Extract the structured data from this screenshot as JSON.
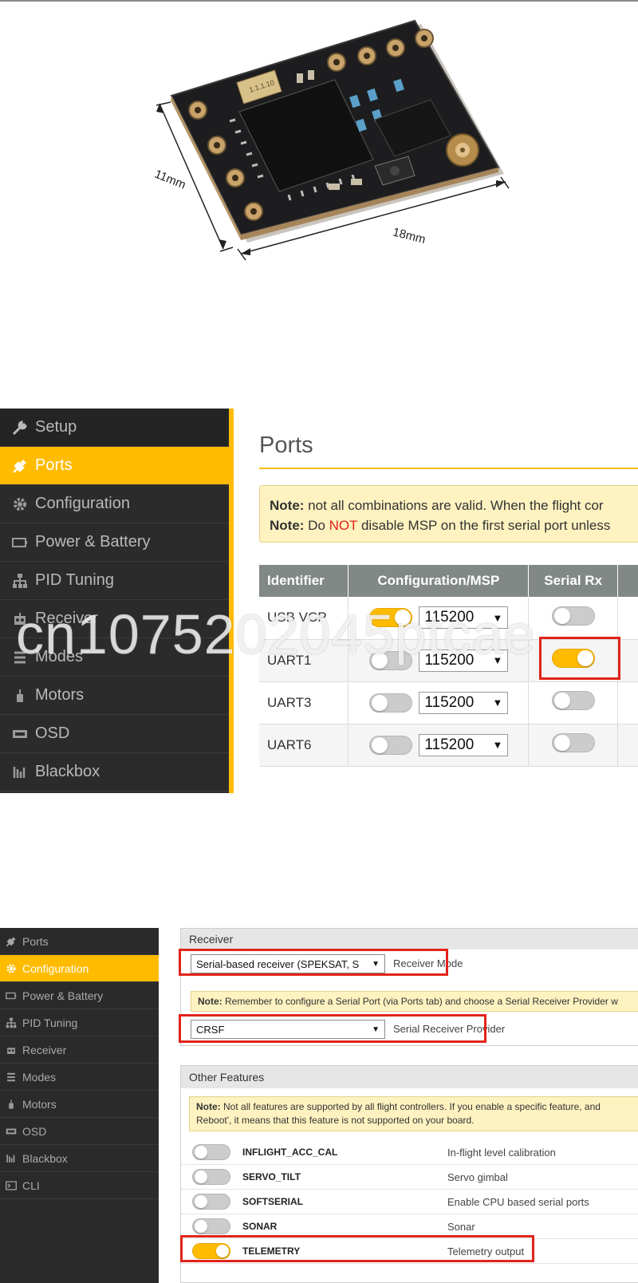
{
  "product_image": {
    "width_label": "11mm",
    "length_label": "18mm",
    "chip_marking": "1.1.1.10"
  },
  "ports_screen": {
    "sidebar": [
      {
        "label": "Setup",
        "icon": "wrench-icon"
      },
      {
        "label": "Ports",
        "icon": "plug-icon"
      },
      {
        "label": "Configuration",
        "icon": "gear-icon"
      },
      {
        "label": "Power & Battery",
        "icon": "battery-icon"
      },
      {
        "label": "PID Tuning",
        "icon": "sitemap-icon"
      },
      {
        "label": "Receiver",
        "icon": "robot-icon"
      },
      {
        "label": "Modes",
        "icon": "modes-icon"
      },
      {
        "label": "Motors",
        "icon": "motor-icon"
      },
      {
        "label": "OSD",
        "icon": "osd-icon"
      },
      {
        "label": "Blackbox",
        "icon": "blackbox-icon"
      }
    ],
    "active_item": "Ports",
    "title": "Ports",
    "note1_bold": "Note:",
    "note1_text": " not all combinations are valid. When the flight cor",
    "note2_bold": "Note:",
    "note2_pre": " Do ",
    "note2_red": "NOT",
    "note2_post": " disable MSP on the first serial port unless",
    "columns": [
      "Identifier",
      "Configuration/MSP",
      "Serial Rx"
    ],
    "rows": [
      {
        "id": "USB VCP",
        "msp_on": true,
        "baud": "115200",
        "serial_rx": false
      },
      {
        "id": "UART1",
        "msp_on": false,
        "baud": "115200",
        "serial_rx": true
      },
      {
        "id": "UART3",
        "msp_on": false,
        "baud": "115200",
        "serial_rx": false
      },
      {
        "id": "UART6",
        "msp_on": false,
        "baud": "115200",
        "serial_rx": false
      }
    ]
  },
  "watermark": "cn1075202045ptcae",
  "config_screen": {
    "sidebar": [
      {
        "label": "Ports",
        "icon": "plug-icon"
      },
      {
        "label": "Configuration",
        "icon": "gear-icon"
      },
      {
        "label": "Power & Battery",
        "icon": "battery-icon"
      },
      {
        "label": "PID Tuning",
        "icon": "sitemap-icon"
      },
      {
        "label": "Receiver",
        "icon": "robot-icon"
      },
      {
        "label": "Modes",
        "icon": "modes-icon"
      },
      {
        "label": "Motors",
        "icon": "motor-icon"
      },
      {
        "label": "OSD",
        "icon": "osd-icon"
      },
      {
        "label": "Blackbox",
        "icon": "blackbox-icon"
      },
      {
        "label": "CLI",
        "icon": "cli-icon"
      }
    ],
    "active_item": "Configuration",
    "receiver": {
      "heading": "Receiver",
      "mode_value": "Serial-based receiver (SPEKSAT, S",
      "mode_label": "Receiver Mode",
      "note_bold": "Note:",
      "note_text": " Remember to configure a Serial Port (via Ports tab) and choose a Serial Receiver Provider w",
      "provider_value": "CRSF",
      "provider_label": "Serial Receiver Provider"
    },
    "features": {
      "heading": "Other Features",
      "note_bold": "Note:",
      "note_line1": " Not all features are supported by all flight controllers. If you enable a specific feature, and",
      "note_line2": "Reboot', it means that this feature is not supported on your board.",
      "items": [
        {
          "name": "INFLIGHT_ACC_CAL",
          "desc": "In-flight level calibration",
          "on": false
        },
        {
          "name": "SERVO_TILT",
          "desc": "Servo gimbal",
          "on": false
        },
        {
          "name": "SOFTSERIAL",
          "desc": "Enable CPU based serial ports",
          "on": false
        },
        {
          "name": "SONAR",
          "desc": "Sonar",
          "on": false
        },
        {
          "name": "TELEMETRY",
          "desc": "Telemetry output",
          "on": true
        }
      ]
    }
  },
  "colors": {
    "accent": "#ffbb00",
    "sidebar_bg": "#2d2d2d",
    "highlight_red": "#e2231a",
    "note_bg": "#fef2c0"
  }
}
